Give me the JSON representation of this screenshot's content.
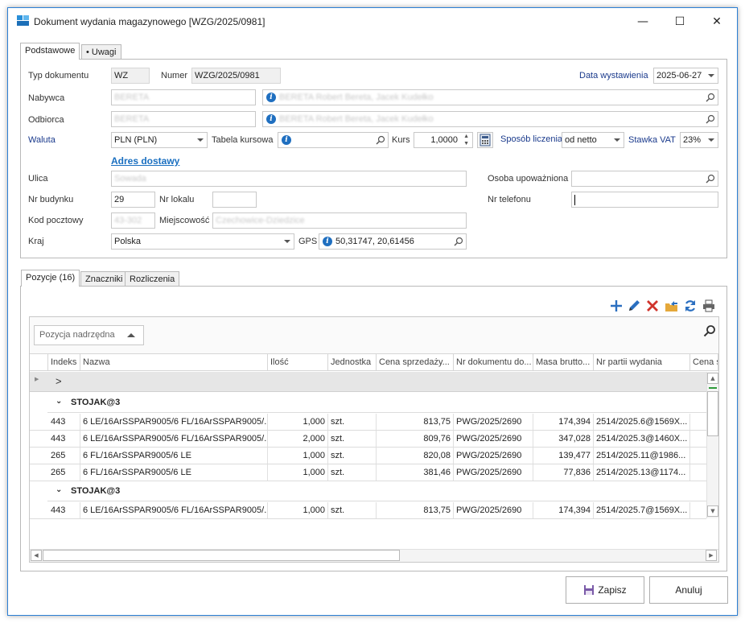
{
  "window": {
    "title": "Dokument wydania magazynowego [WZG/2025/0981]",
    "minimize": "—",
    "maximize": "☐",
    "close": "✕"
  },
  "top_tabs": [
    {
      "label": "Podstawowe"
    },
    {
      "label": "Uwagi",
      "dot": "•"
    }
  ],
  "form": {
    "typ_label": "Typ dokumentu",
    "typ_value": "WZ",
    "numer_label": "Numer",
    "numer_value": "WZG/2025/0981",
    "data_label": "Data wystawienia",
    "data_value": "2025-06-27",
    "nabywca_label": "Nabywca",
    "nabywca_code": "BERETA",
    "nabywca_name": "BERETA Robert Bereta, Jacek Kudełko",
    "odbiorca_label": "Odbiorca",
    "odbiorca_code": "BERETA",
    "odbiorca_name": "BERETA Robert Bereta, Jacek Kudełko",
    "waluta_label": "Waluta",
    "waluta_value": "PLN (PLN)",
    "tabela_label": "Tabela kursowa",
    "kurs_label": "Kurs",
    "kurs_value": "1,0000",
    "sposob_label": "Sposób liczenia",
    "sposob_value": "od netto",
    "stawka_label": "Stawka VAT",
    "stawka_value": "23%",
    "adres_link": "Adres dostawy",
    "ulica_label": "Ulica",
    "ulica_value": "Sowada",
    "osoba_label": "Osoba upoważniona",
    "nrbud_label": "Nr budynku",
    "nrbud_value": "29",
    "nrlok_label": "Nr lokalu",
    "tel_label": "Nr telefonu",
    "kod_label": "Kod pocztowy",
    "kod_value": "43-302",
    "miejsc_label": "Miejscowość",
    "miejsc_value": "Czechowice-Dziedzice",
    "kraj_label": "Kraj",
    "kraj_value": "Polska",
    "gps_label": "GPS",
    "gps_value": "50,31747, 20,61456"
  },
  "lower_tabs": [
    {
      "label": "Pozycje (16)"
    },
    {
      "label": "Znaczniki"
    },
    {
      "label": "Rozliczenia"
    }
  ],
  "toolbar": {
    "add": "add",
    "edit": "edit",
    "delete": "delete",
    "export": "export",
    "refresh": "refresh",
    "print": "print"
  },
  "grid": {
    "group_button": "Pozycja nadrzędna",
    "columns": [
      "Indeks",
      "Nazwa",
      "Ilość",
      "Jednostka",
      "Cena sprzedaży...",
      "Nr dokumentu do...",
      "Masa brutto...",
      "Nr partii wydania",
      "Cena s"
    ],
    "expander": ">",
    "group1": {
      "label": "STOJAK@3",
      "rows": [
        [
          "443",
          "6 LE/16ArSSPAR9005/6 FL/16ArSSPAR9005/...",
          "1,000",
          "szt.",
          "813,75",
          "PWG/2025/2690",
          "174,394",
          "2514/2025.6@1569X..."
        ],
        [
          "443",
          "6 LE/16ArSSPAR9005/6 FL/16ArSSPAR9005/...",
          "2,000",
          "szt.",
          "809,76",
          "PWG/2025/2690",
          "347,028",
          "2514/2025.3@1460X..."
        ],
        [
          "265",
          "6 FL/16ArSSPAR9005/6 LE",
          "1,000",
          "szt.",
          "820,08",
          "PWG/2025/2690",
          "139,477",
          "2514/2025.11@1986..."
        ],
        [
          "265",
          "6 FL/16ArSSPAR9005/6 LE",
          "1,000",
          "szt.",
          "381,46",
          "PWG/2025/2690",
          "77,836",
          "2514/2025.13@1174..."
        ]
      ]
    },
    "group2": {
      "label": "STOJAK@3",
      "rows": [
        [
          "443",
          "6 LE/16ArSSPAR9005/6 FL/16ArSSPAR9005/...",
          "1,000",
          "szt.",
          "813,75",
          "PWG/2025/2690",
          "174,394",
          "2514/2025.7@1569X..."
        ]
      ]
    }
  },
  "buttons": {
    "save": "Zapisz",
    "cancel": "Anuluj"
  }
}
